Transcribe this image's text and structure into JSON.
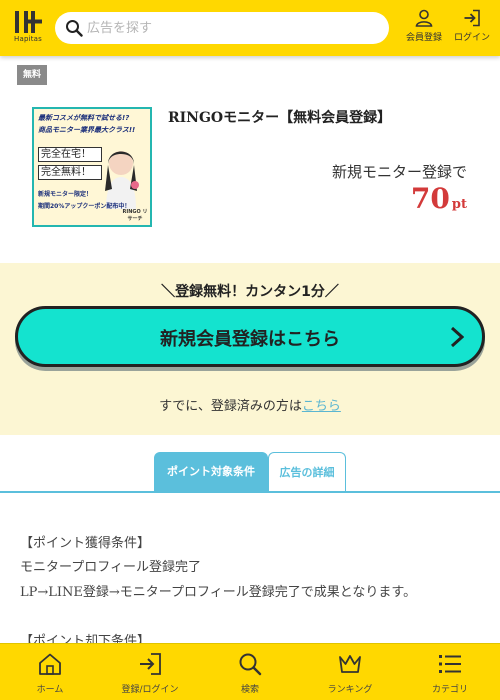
{
  "header": {
    "logo_text": "Hapitas",
    "search_placeholder": "広告を探す",
    "register_label": "会員登録",
    "login_label": "ログイン"
  },
  "ad": {
    "free_tag": "無料",
    "title": "RINGOモニター【無料会員登録】",
    "subtitle": "新規モニター登録で",
    "points_value": "70",
    "points_unit": "pt",
    "thumbnail": {
      "line1": "最新コスメが無料で試せる!?",
      "line2": "商品モニター業界最大クラス!!",
      "box1": "完全在宅！",
      "box2": "完全無料！",
      "small1": "新規モニター限定！",
      "small2": "期間20%アップクーポン配布中！",
      "brand": "RINGO リサーチ"
    }
  },
  "register": {
    "catch": "＼登録無料！カンタン1分／",
    "button_label": "新規会員登録はこちら",
    "already_text": "すでに、登録済みの方は",
    "already_link": "こちら"
  },
  "tabs": [
    {
      "label": "ポイント対象条件",
      "active": true
    },
    {
      "label": "広告の詳細",
      "active": false
    }
  ],
  "conditions": {
    "heading1": "【ポイント獲得条件】",
    "line1": "モニタープロフィール登録完了",
    "line2": "LP→LINE登録→モニタープロフィール登録完了で成果となります。",
    "heading2": "【ポイント却下条件】"
  },
  "bottom_nav": [
    {
      "label": "ホーム",
      "icon": "home-icon"
    },
    {
      "label": "登録/ログイン",
      "icon": "login-icon"
    },
    {
      "label": "検索",
      "icon": "search-icon"
    },
    {
      "label": "ランキング",
      "icon": "crown-icon"
    },
    {
      "label": "カテゴリ",
      "icon": "list-icon"
    }
  ],
  "colors": {
    "brand_yellow": "#ffd800",
    "cta_turquoise": "#14e3cf",
    "tab_blue": "#5bbfdc",
    "points_red": "#d33a3a",
    "register_bg": "#fcf6d3"
  }
}
